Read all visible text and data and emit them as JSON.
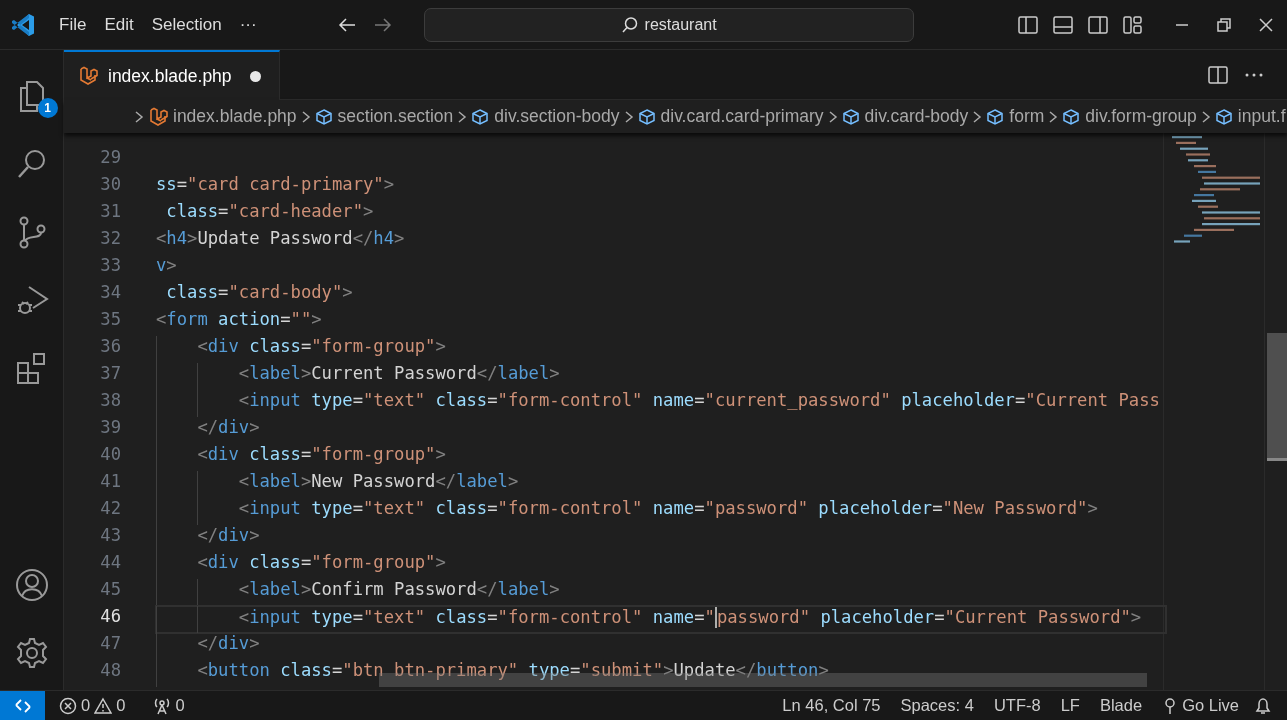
{
  "title_bar": {
    "menu": [
      "File",
      "Edit",
      "Selection",
      "···"
    ],
    "search": "restaurant"
  },
  "activity_bar": {
    "items": [
      {
        "kind": "explorer",
        "badge": "1"
      },
      {
        "kind": "search"
      },
      {
        "kind": "source-control"
      },
      {
        "kind": "run-debug"
      },
      {
        "kind": "extensions"
      }
    ],
    "bottom": [
      {
        "kind": "account"
      },
      {
        "kind": "settings"
      }
    ]
  },
  "tabs": [
    {
      "label": "index.blade.php",
      "selected": true,
      "modified": true
    }
  ],
  "breadcrumbs": [
    {
      "label": "index.blade.php",
      "kind": "file"
    },
    {
      "label": "section.section",
      "kind": "element"
    },
    {
      "label": "div.section-body",
      "kind": "element"
    },
    {
      "label": "div.card.card-primary",
      "kind": "element"
    },
    {
      "label": "div.card-body",
      "kind": "element"
    },
    {
      "label": "form",
      "kind": "element"
    },
    {
      "label": "div.form-group",
      "kind": "element"
    },
    {
      "label": "input.f",
      "kind": "element"
    }
  ],
  "editor": {
    "lines": [
      {
        "number": "29",
        "current": false
      },
      {
        "number": "30",
        "current": false,
        "tokens": [
          {
            "kind": "attr",
            "text": "ss"
          },
          {
            "kind": "op",
            "text": "="
          },
          {
            "kind": "str",
            "text": "\"card card-primary\""
          },
          {
            "kind": "punct",
            "text": ">"
          }
        ]
      },
      {
        "number": "31",
        "current": false,
        "tokens": [
          {
            "kind": "attr",
            "text": " class"
          },
          {
            "kind": "op",
            "text": "="
          },
          {
            "kind": "str",
            "text": "\"card-header\""
          },
          {
            "kind": "punct",
            "text": ">"
          }
        ]
      },
      {
        "number": "32",
        "current": false,
        "tokens": [
          {
            "kind": "punct",
            "text": "<"
          },
          {
            "kind": "tag",
            "text": "h4"
          },
          {
            "kind": "punct",
            "text": ">"
          },
          {
            "kind": "text",
            "text": "Update Password"
          },
          {
            "kind": "punct",
            "text": "</"
          },
          {
            "kind": "tag",
            "text": "h4"
          },
          {
            "kind": "punct",
            "text": ">"
          }
        ]
      },
      {
        "number": "33",
        "current": false,
        "tokens": [
          {
            "kind": "tag",
            "text": "v"
          },
          {
            "kind": "punct",
            "text": ">"
          }
        ]
      },
      {
        "number": "34",
        "current": false,
        "tokens": [
          {
            "kind": "attr",
            "text": " class"
          },
          {
            "kind": "op",
            "text": "="
          },
          {
            "kind": "str",
            "text": "\"card-body\""
          },
          {
            "kind": "punct",
            "text": ">"
          }
        ]
      },
      {
        "number": "35",
        "current": false,
        "tokens": [
          {
            "kind": "punct",
            "text": "<"
          },
          {
            "kind": "tag",
            "text": "form"
          },
          {
            "kind": "attr",
            "text": " action"
          },
          {
            "kind": "op",
            "text": "="
          },
          {
            "kind": "str",
            "text": "\"\""
          },
          {
            "kind": "punct",
            "text": ">"
          }
        ]
      },
      {
        "number": "36",
        "current": false,
        "tokens": [
          {
            "kind": "punct",
            "text": "    <"
          },
          {
            "kind": "tag",
            "text": "div"
          },
          {
            "kind": "attr",
            "text": " class"
          },
          {
            "kind": "op",
            "text": "="
          },
          {
            "kind": "str",
            "text": "\"form-group\""
          },
          {
            "kind": "punct",
            "text": ">"
          }
        ]
      },
      {
        "number": "37",
        "current": false,
        "tokens": [
          {
            "kind": "punct",
            "text": "        <"
          },
          {
            "kind": "tag",
            "text": "label"
          },
          {
            "kind": "punct",
            "text": ">"
          },
          {
            "kind": "text",
            "text": "Current Password"
          },
          {
            "kind": "punct",
            "text": "</"
          },
          {
            "kind": "tag",
            "text": "label"
          },
          {
            "kind": "punct",
            "text": ">"
          }
        ]
      },
      {
        "number": "38",
        "current": false,
        "tokens": [
          {
            "kind": "punct",
            "text": "        <"
          },
          {
            "kind": "tag",
            "text": "input"
          },
          {
            "kind": "attr",
            "text": " type"
          },
          {
            "kind": "op",
            "text": "="
          },
          {
            "kind": "str",
            "text": "\"text\""
          },
          {
            "kind": "attr",
            "text": " class"
          },
          {
            "kind": "op",
            "text": "="
          },
          {
            "kind": "str",
            "text": "\"form-control\""
          },
          {
            "kind": "attr",
            "text": " name"
          },
          {
            "kind": "op",
            "text": "="
          },
          {
            "kind": "str",
            "text": "\"current_password\""
          },
          {
            "kind": "attr",
            "text": " placeholder"
          },
          {
            "kind": "op",
            "text": "="
          },
          {
            "kind": "str",
            "text": "\"Current Pass"
          }
        ]
      },
      {
        "number": "39",
        "current": false,
        "tokens": [
          {
            "kind": "punct",
            "text": "    </"
          },
          {
            "kind": "tag",
            "text": "div"
          },
          {
            "kind": "punct",
            "text": ">"
          }
        ]
      },
      {
        "number": "40",
        "current": false,
        "tokens": [
          {
            "kind": "punct",
            "text": "    <"
          },
          {
            "kind": "tag",
            "text": "div"
          },
          {
            "kind": "attr",
            "text": " class"
          },
          {
            "kind": "op",
            "text": "="
          },
          {
            "kind": "str",
            "text": "\"form-group\""
          },
          {
            "kind": "punct",
            "text": ">"
          }
        ]
      },
      {
        "number": "41",
        "current": false,
        "tokens": [
          {
            "kind": "punct",
            "text": "        <"
          },
          {
            "kind": "tag",
            "text": "label"
          },
          {
            "kind": "punct",
            "text": ">"
          },
          {
            "kind": "text",
            "text": "New Password"
          },
          {
            "kind": "punct",
            "text": "</"
          },
          {
            "kind": "tag",
            "text": "label"
          },
          {
            "kind": "punct",
            "text": ">"
          }
        ]
      },
      {
        "number": "42",
        "current": false,
        "tokens": [
          {
            "kind": "punct",
            "text": "        <"
          },
          {
            "kind": "tag",
            "text": "input"
          },
          {
            "kind": "attr",
            "text": " type"
          },
          {
            "kind": "op",
            "text": "="
          },
          {
            "kind": "str",
            "text": "\"text\""
          },
          {
            "kind": "attr",
            "text": " class"
          },
          {
            "kind": "op",
            "text": "="
          },
          {
            "kind": "str",
            "text": "\"form-control\""
          },
          {
            "kind": "attr",
            "text": " name"
          },
          {
            "kind": "op",
            "text": "="
          },
          {
            "kind": "str",
            "text": "\"password\""
          },
          {
            "kind": "attr",
            "text": " placeholder"
          },
          {
            "kind": "op",
            "text": "="
          },
          {
            "kind": "str",
            "text": "\"New Password\""
          },
          {
            "kind": "punct",
            "text": ">"
          }
        ]
      },
      {
        "number": "43",
        "current": false,
        "tokens": [
          {
            "kind": "punct",
            "text": "    </"
          },
          {
            "kind": "tag",
            "text": "div"
          },
          {
            "kind": "punct",
            "text": ">"
          }
        ]
      },
      {
        "number": "44",
        "current": false,
        "tokens": [
          {
            "kind": "punct",
            "text": "    <"
          },
          {
            "kind": "tag",
            "text": "div"
          },
          {
            "kind": "attr",
            "text": " class"
          },
          {
            "kind": "op",
            "text": "="
          },
          {
            "kind": "str",
            "text": "\"form-group\""
          },
          {
            "kind": "punct",
            "text": ">"
          }
        ]
      },
      {
        "number": "45",
        "current": false,
        "tokens": [
          {
            "kind": "punct",
            "text": "        <"
          },
          {
            "kind": "tag",
            "text": "label"
          },
          {
            "kind": "punct",
            "text": ">"
          },
          {
            "kind": "text",
            "text": "Confirm Password"
          },
          {
            "kind": "punct",
            "text": "</"
          },
          {
            "kind": "tag",
            "text": "label"
          },
          {
            "kind": "punct",
            "text": ">"
          }
        ]
      },
      {
        "number": "46",
        "current": true,
        "tokens": [
          {
            "kind": "punct",
            "text": "        <"
          },
          {
            "kind": "tag",
            "text": "input"
          },
          {
            "kind": "attr",
            "text": " type"
          },
          {
            "kind": "op",
            "text": "="
          },
          {
            "kind": "str",
            "text": "\"text\""
          },
          {
            "kind": "attr",
            "text": " class"
          },
          {
            "kind": "op",
            "text": "="
          },
          {
            "kind": "str",
            "text": "\"form-control\""
          },
          {
            "kind": "attr",
            "text": " name"
          },
          {
            "kind": "op",
            "text": "="
          },
          {
            "kind": "str",
            "text": "\""
          },
          {
            "kind": "caret"
          },
          {
            "kind": "str",
            "text": "password\""
          },
          {
            "kind": "attr",
            "text": " placeholder"
          },
          {
            "kind": "op",
            "text": "="
          },
          {
            "kind": "str",
            "text": "\"Current Password\""
          },
          {
            "kind": "punct",
            "text": ">"
          }
        ]
      },
      {
        "number": "47",
        "current": false,
        "tokens": [
          {
            "kind": "punct",
            "text": "    </"
          },
          {
            "kind": "tag",
            "text": "div"
          },
          {
            "kind": "punct",
            "text": ">"
          }
        ]
      },
      {
        "number": "48",
        "current": false,
        "tokens": [
          {
            "kind": "punct",
            "text": "    <"
          },
          {
            "kind": "tag",
            "text": "button"
          },
          {
            "kind": "attr",
            "text": " class"
          },
          {
            "kind": "op",
            "text": "="
          },
          {
            "kind": "str",
            "text": "\"btn btn-primary\""
          },
          {
            "kind": "attr",
            "text": " type"
          },
          {
            "kind": "op",
            "text": "="
          },
          {
            "kind": "str",
            "text": "\"submit\""
          },
          {
            "kind": "punct",
            "text": ">"
          },
          {
            "kind": "text",
            "text": "Update"
          },
          {
            "kind": "punct",
            "text": "</"
          },
          {
            "kind": "tag",
            "text": "button"
          },
          {
            "kind": "punct",
            "text": ">"
          }
        ]
      }
    ]
  },
  "status_bar": {
    "errors": "0",
    "warnings": "0",
    "ports": "0",
    "position": "Ln 46, Col 75",
    "indent": "Spaces: 4",
    "encoding": "UTF-8",
    "eol": "LF",
    "language": "Blade",
    "go_live": "Go Live"
  }
}
